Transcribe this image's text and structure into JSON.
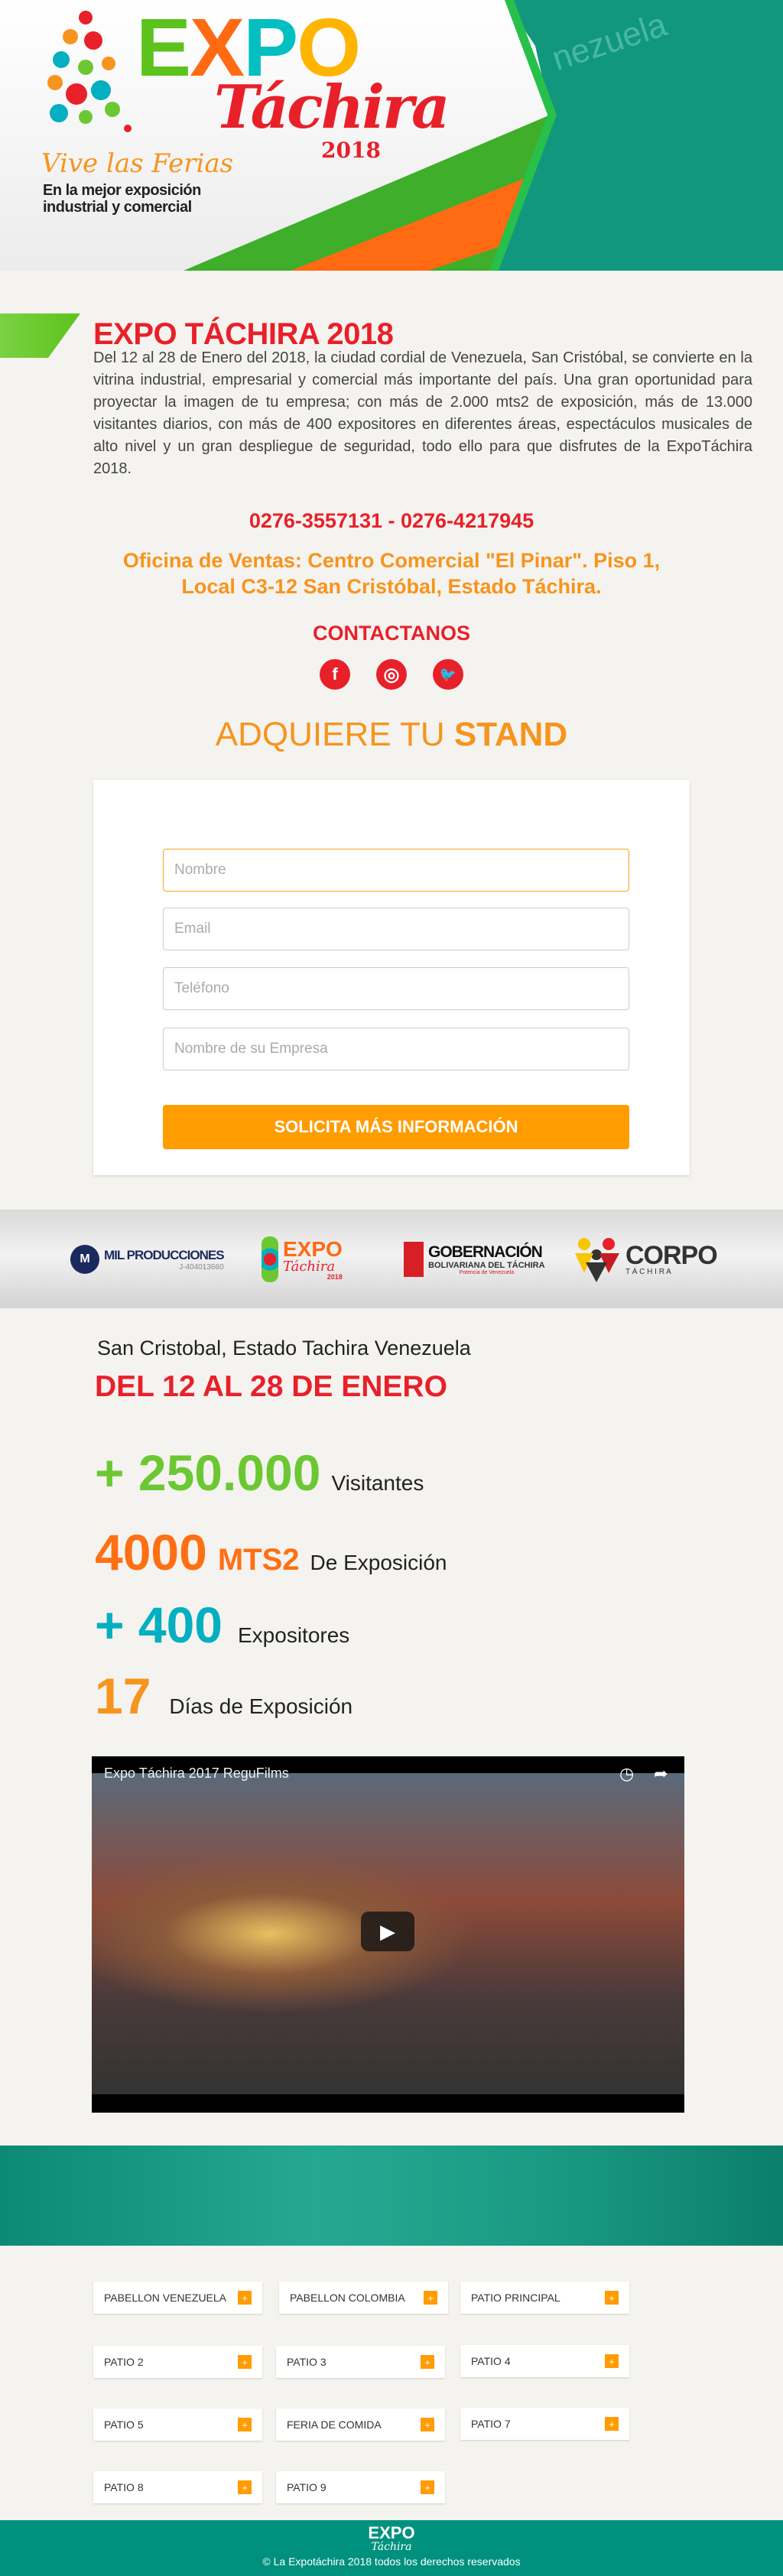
{
  "hero": {
    "logo_expo": [
      "E",
      "X",
      "P",
      "O"
    ],
    "logo_tachira": "Táchira",
    "logo_year": "2018",
    "slogan": "Vive las Ferias",
    "tagline_1": "En la mejor exposición",
    "tagline_2": "industrial y comercial",
    "bg_sign": "nezuela"
  },
  "about": {
    "title": "EXPO TÁCHIRA 2018",
    "paragraph": "Del 12 al 28 de Enero del 2018, la ciudad cordial de Venezuela, San Cristóbal, se convierte en la vitrina industrial, empresarial y comercial más importante del país. Una gran oportunidad para proyectar la imagen de tu empresa; con más de 2.000 mts2 de exposición, más de 13.000 visitantes diarios, con más de 400 expositores en diferentes áreas,  espectáculos musicales de alto nivel y un gran despliegue de seguridad, todo ello para que disfrutes de la ExpoTáchira 2018.",
    "phones": "0276-3557131 - 0276-4217945",
    "address_1": "Oficina de Ventas: Centro Comercial \"El Pinar\". Piso 1,",
    "address_2": "Local C3-12 San Cristóbal, Estado Táchira.",
    "contact_title": "CONTACTANOS",
    "social": [
      {
        "icon": "facebook-icon",
        "glyph": "f"
      },
      {
        "icon": "instagram-icon",
        "glyph": "◎"
      },
      {
        "icon": "twitter-icon",
        "glyph": "🐦"
      }
    ]
  },
  "form": {
    "heading_light": "ADQUIERE TU ",
    "heading_bold": "STAND",
    "fields": [
      {
        "placeholder": "Nombre"
      },
      {
        "placeholder": "Email"
      },
      {
        "placeholder": "Teléfono"
      },
      {
        "placeholder": "Nombre de su Empresa"
      }
    ],
    "submit_label": "SOLICITA MÁS INFORMACIÓN"
  },
  "sponsors": {
    "mil": "MIL PRODUCCIONES",
    "mil_rif": "J-404013660",
    "expo": "EXPO",
    "expo_sub": "Táchira",
    "expo_year": "2018",
    "gob": "GOBERNACIÓN",
    "gob_sub": "BOLIVARIANA DEL TÁCHIRA",
    "gob_tag": "Potencia de Venezuela",
    "corpo": "CORPO",
    "corpo_sub": "T Á C H I R A"
  },
  "stats": {
    "location": "San Cristobal, Estado Tachira Venezuela",
    "dates": "DEL 12 AL 28 DE ENERO",
    "items": [
      {
        "value": "+ 250.000",
        "unit": "",
        "label": "Visitantes",
        "color": "#6cc832"
      },
      {
        "value": "4000",
        "unit": "MTS2",
        "label": "De Exposición",
        "color": "#ff6f13"
      },
      {
        "value": "+ 400",
        "unit": "",
        "label": "Expositores",
        "color": "#03afc0"
      },
      {
        "value": "17",
        "unit": "",
        "label": "Días de Exposición",
        "color": "#f7941d"
      }
    ]
  },
  "video": {
    "title": "Expo Táchira 2017 ReguFilms"
  },
  "areas": [
    "PABELLON VENEZUELA",
    "PABELLON COLOMBIA",
    "PATIO PRINCIPAL",
    "PATIO 2",
    "PATIO 3",
    "PATIO 4",
    "PATIO 5",
    "FERIA DE COMIDA",
    "PATIO 7",
    "PATIO 8",
    "PATIO 9"
  ],
  "footer": {
    "logo_expo": "EXPO",
    "logo_sub": "Táchira",
    "copyright": "© La Expotáchira 2018 todos los derechos reservados"
  },
  "colors": {
    "red": "#e8202a",
    "orange": "#ff9c00",
    "teal": "#00917e",
    "green": "#6cc832"
  }
}
